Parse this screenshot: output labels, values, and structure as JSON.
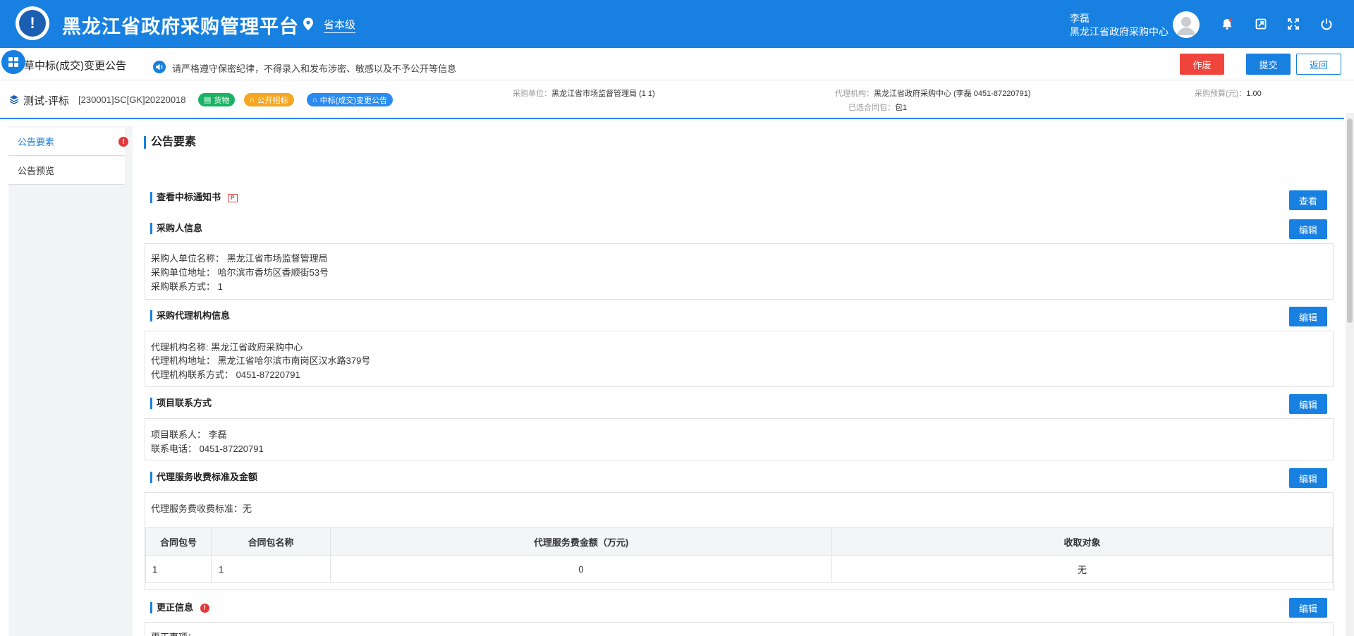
{
  "header": {
    "title": "黑龙江省政府采购管理平台",
    "logo_mark": "!",
    "location": "省本级",
    "user_name": "李磊",
    "user_org": "黑龙江省政府采购中心",
    "icons": [
      "bell-icon",
      "exit-window-icon",
      "fullscreen-icon",
      "power-icon"
    ]
  },
  "notice": {
    "page_heading": "草中标(成交)变更公告",
    "message": "请严格遵守保密纪律，不得录入和发布涉密、敏感以及不予公开等信息",
    "void_label": "作废",
    "submit_label": "提交",
    "back_label": "返回"
  },
  "project": {
    "name": "测试-评标",
    "code": "[230001]SC[GK]20220018",
    "tags": [
      "货物",
      "公开招标",
      "中标(成交)变更公告"
    ],
    "purchaser_label": "采购单位：",
    "purchaser_value": "黑龙江省市场监督管理局 (1 1)",
    "agency_label": "代理机构：",
    "agency_value": "黑龙江省政府采购中心 (李磊 0451-87220791)",
    "package_label": "已选合同包：",
    "package_value": "包1",
    "budget_label": "采购预算(元)：",
    "budget_value": "1.00"
  },
  "sidebar": {
    "items": [
      {
        "label": "公告要素",
        "active": true,
        "has_error": true
      },
      {
        "label": "公告预览",
        "active": false,
        "has_error": false
      }
    ]
  },
  "main": {
    "title": "公告要素",
    "edit_label": "编辑",
    "view_label": "查看",
    "sections": {
      "award_notice": {
        "title": "查看中标通知书"
      },
      "purchaser": {
        "title": "采购人信息",
        "lines": [
          "采购人单位名称：  黑龙江省市场监督管理局",
          "采购单位地址：  哈尔滨市香坊区香顺街53号",
          "采购联系方式：  1"
        ]
      },
      "agency": {
        "title": "采购代理机构信息",
        "lines": [
          "代理机构名称: 黑龙江省政府采购中心",
          "代理机构地址：  黑龙江省哈尔滨市南岗区汉水路379号",
          "代理机构联系方式：  0451-87220791"
        ]
      },
      "contact": {
        "title": "项目联系方式",
        "lines": [
          "项目联系人：  李磊",
          "联系电话：  0451-87220791"
        ]
      },
      "fee": {
        "title": "代理服务收费标准及金额",
        "standard": "代理服务费收费标准：无",
        "columns": [
          "合同包号",
          "合同包名称",
          "代理服务费金额（万元)",
          "收取对象"
        ],
        "rows": [
          [
            "1",
            "1",
            "0",
            "无"
          ]
        ]
      },
      "correction": {
        "title": "更正信息",
        "first_line": "更正事项："
      }
    }
  },
  "colors": {
    "primary": "#1780e0",
    "danger": "#f0453c",
    "tag_green": "#19b463",
    "tag_orange": "#f5a623",
    "tag_blue": "#2a8af0"
  }
}
